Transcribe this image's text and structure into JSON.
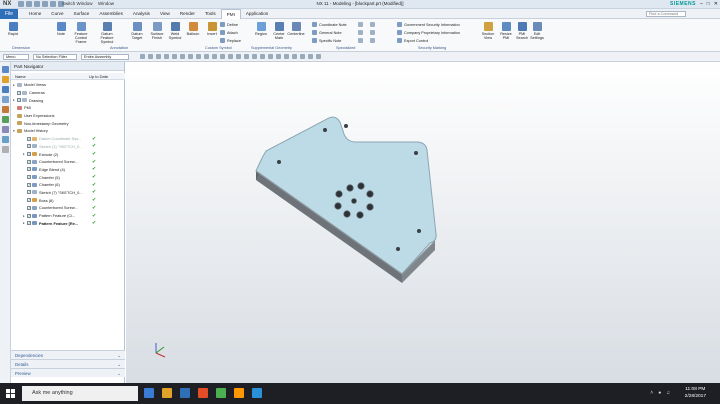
{
  "titlebar": {
    "app_logo": "NX",
    "switch_window": "Switch Window",
    "window_menu": "Window",
    "title": "NX 11 - Modeling - [blockpart.prt (Modified)]",
    "brand": "SIEMENS"
  },
  "menubar": {
    "file": "File",
    "items": [
      "Home",
      "Curve",
      "Surface",
      "Assemblies",
      "Analysis",
      "View",
      "Render",
      "Tools",
      "PMI",
      "Application"
    ],
    "active": "PMI",
    "search_placeholder": "Find a Command"
  },
  "ribbon": {
    "buttons_large": [
      {
        "label": "Rapid",
        "color": "#4b7fc1"
      },
      {
        "label": "Note",
        "color": "#5a88c8"
      },
      {
        "label": "Feature Control Frame",
        "color": "#6b93c9"
      },
      {
        "label": "Datum Feature Symbol",
        "color": "#5b7fb0"
      },
      {
        "label": "Datum Target",
        "color": "#6a8fc0"
      },
      {
        "label": "Surface Finish",
        "color": "#7c9bc4"
      },
      {
        "label": "Weld Symbol",
        "color": "#557bad"
      },
      {
        "label": "Balloon",
        "color": "#d18b3c"
      },
      {
        "label": "Insert",
        "color": "#c89434"
      },
      {
        "label": "Region",
        "color": "#6da0d6"
      },
      {
        "label": "Center Mark",
        "color": "#5a7fb3"
      },
      {
        "label": "Centerline",
        "color": "#6a88b5"
      },
      {
        "label": "Section View",
        "color": "#d1a140"
      },
      {
        "label": "Resize PMI",
        "color": "#5e8bc0"
      },
      {
        "label": "PMI Search",
        "color": "#4d7ab2"
      },
      {
        "label": "Edit Settings",
        "color": "#6b8cba"
      }
    ],
    "buttons_small": [
      "Define",
      "Attach",
      "Replace",
      "Coordinate Note",
      "General Note",
      "Specific Note",
      "Government Security Information",
      "Company Proprietary Information",
      "Export Control"
    ],
    "groups": [
      "Dimension",
      "Annotation",
      "Custom Symbol",
      "Supplemental Geometry",
      "Specialized",
      "Security Marking"
    ]
  },
  "selection_bar": {
    "menu_label": "Menu",
    "filter": "No Selection Filter",
    "scope": "Entire Assembly"
  },
  "navigator": {
    "title": "Part Navigator",
    "col_name": "Name",
    "col_uptodate": "Up to Date",
    "rows": [
      {
        "label": "Model Views",
        "color": "#a8b6c6",
        "expand": "+",
        "indent": 2,
        "check": false,
        "tick": false,
        "style": ""
      },
      {
        "label": "Cameras",
        "color": "#a8b6c6",
        "expand": "",
        "indent": 2,
        "check": true,
        "tick": false,
        "style": ""
      },
      {
        "label": "Drawing",
        "color": "#a8b6c6",
        "expand": "+",
        "indent": 2,
        "check": true,
        "tick": false,
        "style": ""
      },
      {
        "label": "PMI",
        "color": "#d17a7a",
        "expand": "",
        "indent": 2,
        "check": false,
        "tick": false,
        "style": ""
      },
      {
        "label": "User Expressions",
        "color": "#c7a35a",
        "expand": "",
        "indent": 2,
        "check": false,
        "tick": false,
        "style": ""
      },
      {
        "label": "Non-timestamp Geometry",
        "color": "#c7a35a",
        "expand": "",
        "indent": 2,
        "check": false,
        "tick": false,
        "style": ""
      },
      {
        "label": "Model History",
        "color": "#c7a35a",
        "expand": "-",
        "indent": 2,
        "check": false,
        "tick": false,
        "style": ""
      },
      {
        "label": "Datum Coordinate Sys...",
        "color": "#e3b36b",
        "expand": "",
        "indent": 12,
        "check": true,
        "tick": true,
        "style": "dim"
      },
      {
        "label": "Sketch (1) \"SKETCH_0...",
        "color": "#9fb1c6",
        "expand": "",
        "indent": 12,
        "check": true,
        "tick": true,
        "style": "dim"
      },
      {
        "label": "Extrude (2)",
        "color": "#d6a04a",
        "expand": "+",
        "indent": 12,
        "check": true,
        "tick": true,
        "style": ""
      },
      {
        "label": "Counterbored Screw...",
        "color": "#8aa3c0",
        "expand": "",
        "indent": 12,
        "check": true,
        "tick": true,
        "style": ""
      },
      {
        "label": "Edge Blend (4)",
        "color": "#7e9bc2",
        "expand": "",
        "indent": 12,
        "check": true,
        "tick": true,
        "style": ""
      },
      {
        "label": "Chamfer (5)",
        "color": "#7e9bc2",
        "expand": "",
        "indent": 12,
        "check": true,
        "tick": true,
        "style": ""
      },
      {
        "label": "Chamfer (6)",
        "color": "#7e9bc2",
        "expand": "",
        "indent": 12,
        "check": true,
        "tick": true,
        "style": ""
      },
      {
        "label": "Sketch (7) \"SKETCH_0...",
        "color": "#9fb1c6",
        "expand": "",
        "indent": 12,
        "check": true,
        "tick": true,
        "style": ""
      },
      {
        "label": "Boss (8)",
        "color": "#d6a04a",
        "expand": "",
        "indent": 12,
        "check": true,
        "tick": true,
        "style": ""
      },
      {
        "label": "Counterbored Screw...",
        "color": "#8aa3c0",
        "expand": "",
        "indent": 12,
        "check": true,
        "tick": true,
        "style": ""
      },
      {
        "label": "Pattern Feature (Ci...",
        "color": "#7a96bd",
        "expand": "+",
        "indent": 12,
        "check": true,
        "tick": true,
        "style": ""
      },
      {
        "label": "Pattern Feature [Re...",
        "color": "#7a96bd",
        "expand": "+",
        "indent": 12,
        "check": true,
        "tick": true,
        "style": "bold"
      }
    ],
    "sections": [
      "Dependencies",
      "Details",
      "Preview"
    ]
  },
  "taskbar": {
    "search_placeholder": "Ask me anything",
    "time": "11:08 PM",
    "date": "2/28/2017",
    "apps": [
      "#3a7bd5",
      "#e0a228",
      "#2f6fb8",
      "#e44d26",
      "#4caf50",
      "#ff9800",
      "#2a90d8"
    ]
  }
}
